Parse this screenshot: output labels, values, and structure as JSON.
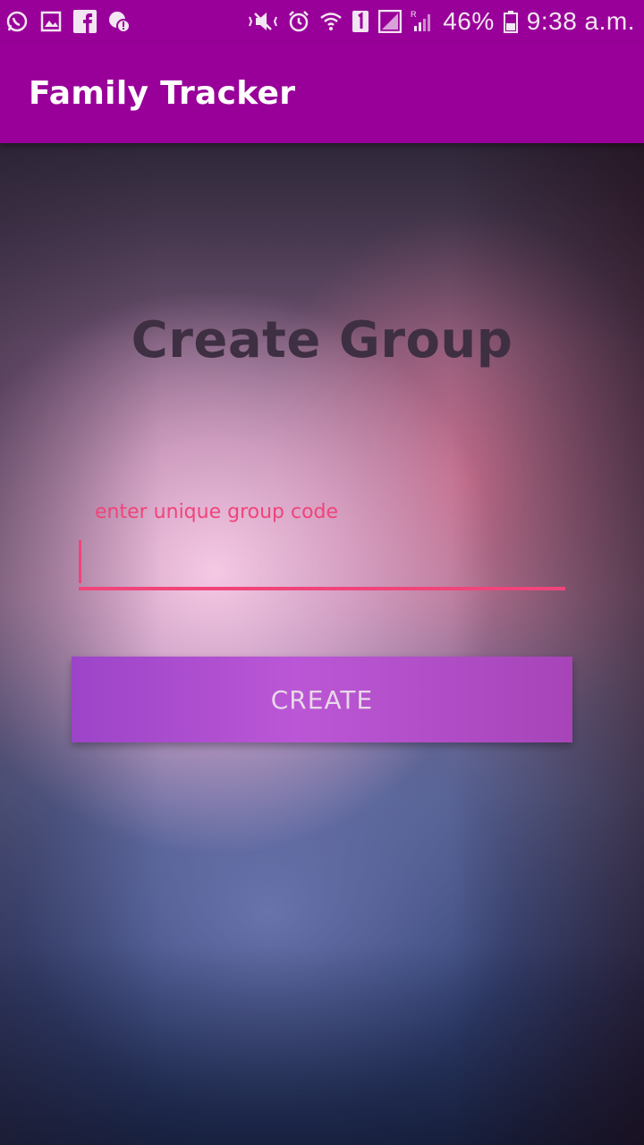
{
  "status_bar": {
    "left_icons": [
      "whatsapp-icon",
      "gallery-icon",
      "facebook-icon",
      "chat-alert-icon"
    ],
    "right_icons": [
      "vibrate-icon",
      "alarm-icon",
      "wifi-icon",
      "sim1-icon",
      "signal-icon",
      "roaming-signal-icon",
      "battery-icon"
    ],
    "battery": "46%",
    "time": "9:38 a.m."
  },
  "app_bar": {
    "title": "Family Tracker"
  },
  "main": {
    "heading": "Create Group",
    "input": {
      "label": "enter unique group code",
      "value": ""
    },
    "button": {
      "label": "CREATE"
    }
  },
  "colors": {
    "primary": "#990099",
    "accent": "#f0447a",
    "button": "#bb57d6"
  }
}
